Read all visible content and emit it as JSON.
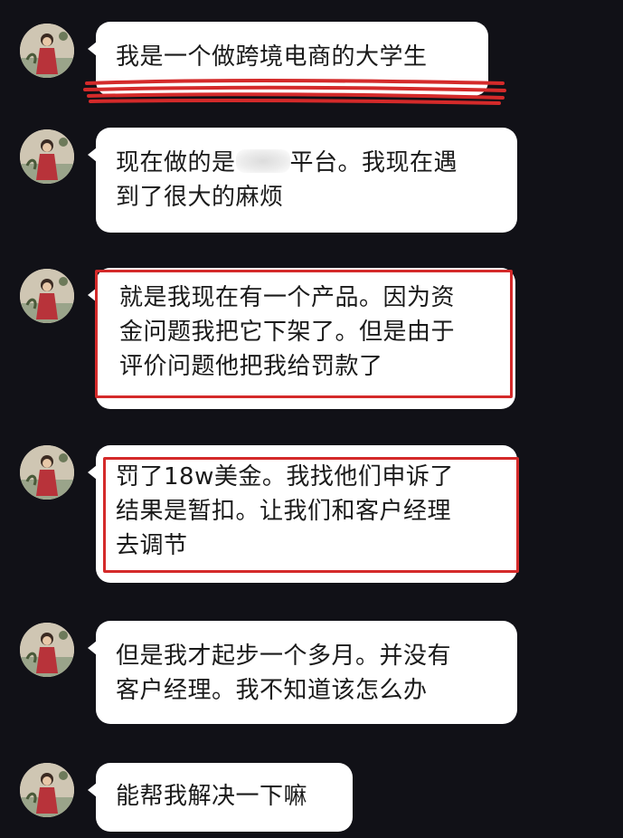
{
  "messages": [
    {
      "lines": [
        "我是一个做跨境电商的大学生"
      ],
      "highlighted": false,
      "underlined": true
    },
    {
      "lines": [
        "现在做的是[redacted]平台。我现在遇",
        "到了很大的麻烦"
      ],
      "line1_before": "现在做的是",
      "line1_after": "平台。我现在遇",
      "highlighted": false
    },
    {
      "lines": [
        "就是我现在有一个产品。因为资",
        "金问题我把它下架了。但是由于",
        "评价问题他把我给罚款了"
      ],
      "highlighted": true
    },
    {
      "lines": [
        "罚了18w美金。我找他们申诉了",
        "结果是暂扣。让我们和客户经理",
        "去调节"
      ],
      "highlighted": true
    },
    {
      "lines": [
        "但是我才起步一个多月。并没有",
        "客户经理。我不知道该怎么办"
      ],
      "highlighted": false
    },
    {
      "lines": [
        "能帮我解决一下嘛"
      ],
      "highlighted": false
    }
  ],
  "colors": {
    "background": "#111117",
    "bubble": "#ffffff",
    "text": "#1a1a1a",
    "annotation_red": "#d42a2a"
  },
  "icons": {
    "avatar": "avatar-icon"
  }
}
